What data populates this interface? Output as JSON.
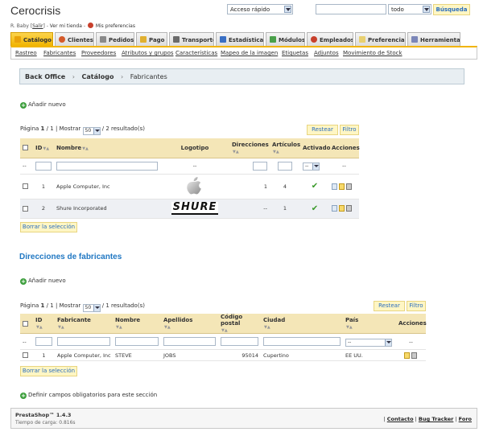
{
  "header": {
    "shop_name": "Cerocrisis",
    "user_name": "R. Baby",
    "logout_label": "Salir",
    "view_shop_label": "Ver mi tienda",
    "preferences_label": "Mis preferencias",
    "quick_access": "Acceso rápido",
    "search_value": "",
    "search_scope": "todo",
    "search_button": "Búsqueda"
  },
  "tabs": [
    {
      "label": "Catálogo",
      "icon": "folder-icon",
      "active": true
    },
    {
      "label": "Clientes",
      "icon": "user-icon",
      "active": false
    },
    {
      "label": "Pedidos",
      "icon": "cart-icon",
      "active": false
    },
    {
      "label": "Pago",
      "icon": "payment-icon",
      "active": false
    },
    {
      "label": "Transporte",
      "icon": "truck-icon",
      "active": false
    },
    {
      "label": "Estadísticas",
      "icon": "chart-icon",
      "active": false
    },
    {
      "label": "Módulos",
      "icon": "puzzle-icon",
      "active": false
    },
    {
      "label": "Empleados",
      "icon": "employee-icon",
      "active": false
    },
    {
      "label": "Preferencias",
      "icon": "preferences-icon",
      "active": false
    },
    {
      "label": "Herramientas",
      "icon": "tools-icon",
      "active": false
    }
  ],
  "subtabs": [
    "Rastreo",
    "Fabricantes",
    "Proveedores",
    "Atributos y grupos",
    "Características",
    "Mapeo de la imagen",
    "Etiquetas",
    "Adjuntos",
    "Movimiento de Stock"
  ],
  "breadcrumb": {
    "root": "Back Office",
    "section": "Catálogo",
    "current": "Fabricantes"
  },
  "manufacturers": {
    "add_label": "Añadir nuevo",
    "pager": {
      "prefix": "Página",
      "page": "1",
      "total": "/ 1",
      "show_label": "| Mostrar",
      "per_page": "50",
      "result": "/ 2 resultado(s)"
    },
    "reset_label": "Restear",
    "filter_label": "Filtro",
    "columns": {
      "id": "ID",
      "name": "Nombre",
      "logo": "Logotipo",
      "addresses": "Direcciones",
      "products": "Artículos",
      "active": "Activado",
      "actions": "Acciones"
    },
    "filter_row": {
      "placeholder": "--",
      "active_select": "--",
      "logo_placeholder": "--",
      "actions_placeholder": "--"
    },
    "rows": [
      {
        "id": "1",
        "name": "Apple Computer, Inc",
        "logo": "apple-logo",
        "addresses": "1",
        "products": "4",
        "active": "✔"
      },
      {
        "id": "2",
        "name": "Shure Incorporated",
        "logo": "SHURE",
        "addresses": "--",
        "products": "1",
        "active": "✔"
      }
    ],
    "delete_selection": "Borrar la selección"
  },
  "addresses": {
    "title": "Direcciones de fabricantes",
    "add_label": "Añadir nuevo",
    "pager": {
      "prefix": "Página",
      "page": "1",
      "total": "/ 1",
      "show_label": "| Mostrar",
      "per_page": "50",
      "result": "/ 1 resultado(s)"
    },
    "reset_label": "Restear",
    "filter_label": "Filtro",
    "columns": {
      "id": "ID",
      "manufacturer": "Fabricante",
      "first_name": "Nombre",
      "last_name": "Apellidos",
      "postcode": "Código postal",
      "city": "Ciudad",
      "country": "País",
      "actions": "Acciones"
    },
    "filter_row": {
      "placeholder": "--",
      "country_select": "--",
      "actions_placeholder": "--"
    },
    "rows": [
      {
        "id": "1",
        "manufacturer": "Apple Computer, Inc",
        "first_name": "STEVE",
        "last_name": "JOBS",
        "postcode": "95014",
        "city": "Cupertino",
        "country": "EE UU."
      }
    ],
    "delete_selection": "Borrar la selección"
  },
  "required_fields_label": "Definir campos obligatorios para este sección",
  "footer": {
    "version": "PrestaShop™ 1.4.3",
    "load_time": "Tiempo de carga: 0.816s",
    "contact": "Contacto",
    "bug_tracker": "Bug Tracker",
    "forum": "Foro"
  },
  "colors": {
    "accent": "#f1b400",
    "link": "#2178c3",
    "table_header": "#f4e6b7"
  }
}
